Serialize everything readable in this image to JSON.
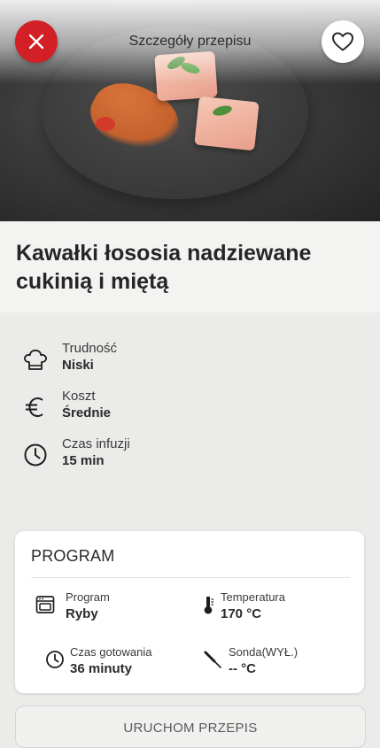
{
  "header": {
    "title": "Szczegóły przepisu"
  },
  "hero": {
    "image_subject": "salmon-dish-photo"
  },
  "recipe": {
    "title": "Kawałki łososia nadziewane cukinią i miętą"
  },
  "info": [
    {
      "icon": "chef-hat-icon",
      "label": "Trudność",
      "value": "Niski"
    },
    {
      "icon": "euro-icon",
      "label": "Koszt",
      "value": "Średnie"
    },
    {
      "icon": "clock-icon",
      "label": "Czas infuzji",
      "value": "15 min"
    }
  ],
  "program": {
    "heading": "PROGRAM",
    "items": [
      {
        "icon": "oven-icon",
        "label": "Program",
        "value": "Ryby"
      },
      {
        "icon": "thermometer-icon",
        "label": "Temperatura",
        "value": "170 °C"
      },
      {
        "icon": "clock-icon",
        "label": "Czas gotowania",
        "value": "36 minuty"
      },
      {
        "icon": "probe-icon",
        "label": "Sonda(WYŁ.)",
        "value": "-- °C"
      }
    ]
  },
  "actions": {
    "run_label": "URUCHOM PRZEPIS"
  },
  "colors": {
    "accent_red": "#d31f26",
    "background": "#ebebe9",
    "card": "#ffffff"
  }
}
